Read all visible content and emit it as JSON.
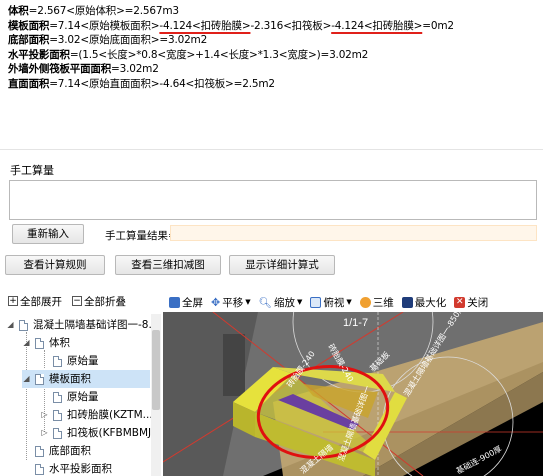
{
  "formula": {
    "line1": {
      "key": "体积",
      "text": "=2.567<原始体积>=2.567m3"
    },
    "line2": {
      "key": "模板面积",
      "p1": "=7.14<原始模板面积>",
      "u1": "-4.124<扣砖胎膜>",
      "p2": "-2.316<扣筏板>",
      "u2": "-4.124<扣砖胎膜>",
      "p3": "=0m2"
    },
    "line3": {
      "key": "底部面积",
      "text": "=3.02<原始底面面积>=3.02m2"
    },
    "line4": {
      "key": "水平投影面积",
      "text": "=(1.5<长度>*0.8<宽度>+1.4<长度>*1.3<宽度>)=3.02m2"
    },
    "line5": {
      "key": "外墙外侧筏板平面面积",
      "text": "=3.02m2"
    },
    "line6": {
      "key": "直面面积",
      "text": "=7.14<原始直面面积>-4.64<扣筏板>=2.5m2"
    }
  },
  "manual": {
    "label": "手工算量",
    "reinput_button": "重新输入",
    "result_label": "手工算量结果="
  },
  "actions": {
    "view_rule": "查看计算规则",
    "view_3d": "查看三维扣减图",
    "show_detail": "显示详细计算式"
  },
  "tree_toolbar": {
    "expand_all": "全部展开",
    "collapse_all": "全部折叠"
  },
  "tree": {
    "root": "混凝土隔墙基础详图一-8...",
    "n1": "体积",
    "n1a": "原始量",
    "n2": "模板面积",
    "n2a": "原始量",
    "n2b": "扣砖胎膜(KZTM...",
    "n2c": "扣筏板(KFBMBMJ)",
    "n3": "底部面积",
    "n4": "水平投影面积"
  },
  "view_toolbar": {
    "fullscreen": "全屏",
    "pan": "平移",
    "zoom": "缩放",
    "view": "俯视",
    "threed": "三维",
    "maximize": "最大化",
    "close": "关闭"
  },
  "scene": {
    "axis_label": "1/1-7",
    "label_a": "砖胎膜-240",
    "label_b": "砖胎膜-240",
    "label_c": "混凝土隔墙基础详图一-850厚 7.14",
    "label_d": "混凝土隔墙基础详图一",
    "label_e": "基础板",
    "label_f": "基础连-900厚",
    "label_g": "混凝土隔墙"
  },
  "colors": {
    "underline": "#e0201a",
    "selection": "#cde3f7",
    "result_field": "#fff6ea",
    "block_yellow": "#d9d43a",
    "block_purple": "#6a3fa0"
  }
}
